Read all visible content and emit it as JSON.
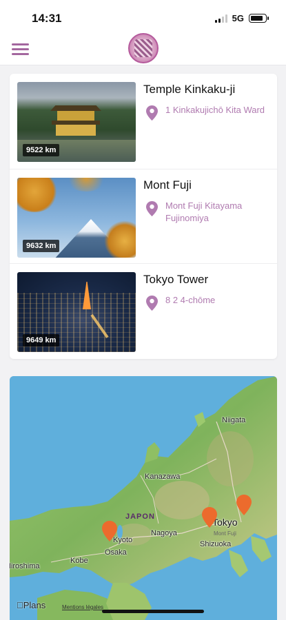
{
  "status_bar": {
    "time": "14:31",
    "network": "5G",
    "signal_bars_active": 2,
    "signal_bars_total": 4
  },
  "header": {
    "menu_icon": "hamburger-menu-icon",
    "logo_icon": "app-logo"
  },
  "places": [
    {
      "name": "Temple Kinkaku-ji",
      "address": "1 Kinkakujichō Kita Ward",
      "distance": "9522 km"
    },
    {
      "name": "Mont Fuji",
      "address": "Mont Fuji Kitayama Fujinomiya",
      "distance": "9632 km"
    },
    {
      "name": "Tokyo Tower",
      "address": "8 2 4-chōme",
      "distance": "9649 km"
    }
  ],
  "map": {
    "labels": {
      "niigata": "Niigata",
      "kanazawa": "Kanazawa",
      "japon": "JAPON",
      "kyoto": "Kyoto",
      "nagoya": "Nagoya",
      "tokyo": "Tokyo",
      "shizuoka": "Shizuoka",
      "osaka": "Osaka",
      "kobe": "Kobe",
      "hiroshima": "Hiroshima",
      "mont_fuji": "Mont Fuji"
    },
    "attribution": "Plans",
    "legal": "Mentions légales",
    "marker_color": "#ec6b2d"
  },
  "colors": {
    "accent": "#a3669e",
    "address_text": "#b07bb0"
  }
}
